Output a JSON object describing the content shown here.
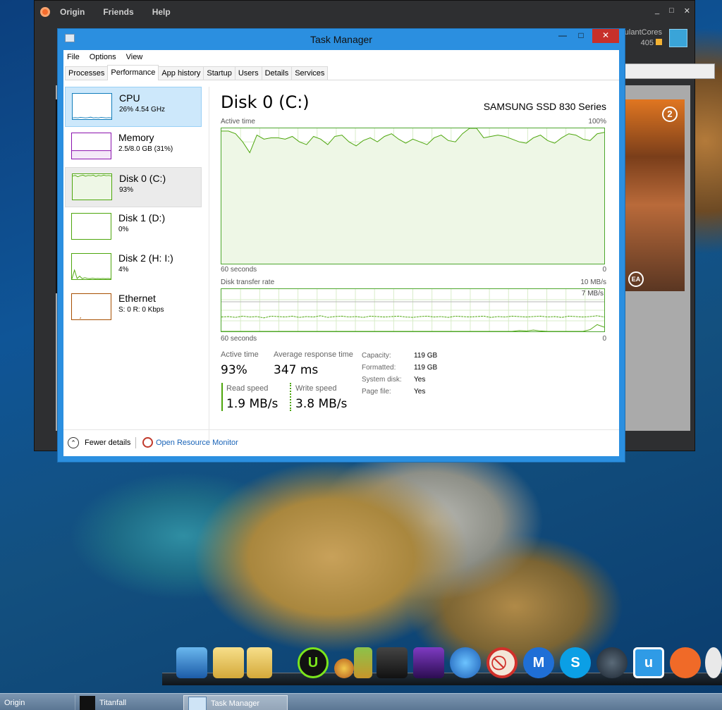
{
  "origin": {
    "menu": [
      "Origin",
      "Friends",
      "Help"
    ],
    "window_controls": [
      "_",
      "□",
      "✕"
    ],
    "user_name": "ulantCores",
    "user_points": "405"
  },
  "task_manager": {
    "title": "Task Manager",
    "menu": [
      "File",
      "Options",
      "View"
    ],
    "tabs": [
      "Processes",
      "Performance",
      "App history",
      "Startup",
      "Users",
      "Details",
      "Services"
    ],
    "active_tab": "Performance",
    "sidebar": [
      {
        "name": "CPU",
        "value": "26% 4.54 GHz",
        "color": "#117dbb"
      },
      {
        "name": "Memory",
        "value": "2.5/8.0 GB (31%)",
        "color": "#8b12ae"
      },
      {
        "name": "Disk 0 (C:)",
        "value": "93%",
        "color": "#4da60c"
      },
      {
        "name": "Disk 1 (D:)",
        "value": "0%",
        "color": "#4da60c"
      },
      {
        "name": "Disk 2 (H: I:)",
        "value": "4%",
        "color": "#4da60c"
      },
      {
        "name": "Ethernet",
        "value": "S: 0 R: 0 Kbps",
        "color": "#a74f01"
      }
    ],
    "detail": {
      "title": "Disk 0 (C:)",
      "model": "SAMSUNG SSD 830 Series",
      "graph1": {
        "label": "Active time",
        "max": "100%",
        "xlabel": "60 seconds",
        "xend": "0"
      },
      "graph2": {
        "label": "Disk transfer rate",
        "max": "10 MB/s",
        "line_label": "7 MB/s",
        "xlabel": "60 seconds",
        "xend": "0"
      },
      "stats": {
        "active_time_label": "Active time",
        "active_time": "93%",
        "avg_response_label": "Average response time",
        "avg_response": "347 ms",
        "read_label": "Read speed",
        "read": "1.9 MB/s",
        "write_label": "Write speed",
        "write": "3.8 MB/s"
      },
      "props": [
        {
          "key": "Capacity:",
          "value": "119 GB"
        },
        {
          "key": "Formatted:",
          "value": "119 GB"
        },
        {
          "key": "System disk:",
          "value": "Yes"
        },
        {
          "key": "Page file:",
          "value": "Yes"
        }
      ]
    },
    "footer": {
      "fewer": "Fewer details",
      "resource_monitor": "Open Resource Monitor"
    },
    "active_time_series": [
      98,
      98,
      96,
      90,
      82,
      95,
      92,
      93,
      93,
      92,
      94,
      90,
      88,
      94,
      92,
      88,
      94,
      95,
      90,
      87,
      91,
      93,
      90,
      94,
      96,
      92,
      89,
      92,
      90,
      88,
      93,
      95,
      91,
      90,
      96,
      100,
      100,
      93,
      94,
      95,
      94,
      92,
      90,
      89,
      93,
      95,
      91,
      89,
      93,
      96,
      95,
      92,
      91,
      96,
      97
    ],
    "transfer_series": [
      3.4,
      3.5,
      3.3,
      3.6,
      3.4,
      3.5,
      3.2,
      3.6,
      3.5,
      3.4,
      3.6,
      3.3,
      3.5,
      3.4,
      3.7,
      3.3,
      3.5,
      3.6,
      3.4,
      3.5,
      3.3,
      3.6,
      3.5,
      3.4,
      3.5,
      3.6,
      3.4,
      3.3,
      3.5,
      3.6,
      3.4,
      3.5,
      3.3,
      3.6,
      3.5,
      3.4,
      3.5,
      3.6,
      3.3,
      3.5,
      3.4,
      3.6,
      3.5,
      3.4,
      3.5,
      3.6,
      3.4,
      3.5,
      3.3,
      3.6,
      3.5,
      3.4,
      3.5,
      3.7,
      3.4
    ],
    "transfer_series2": [
      0,
      0,
      0,
      0,
      0,
      0,
      0,
      0,
      0,
      0,
      0,
      0,
      0,
      0,
      0,
      0,
      0,
      0,
      0,
      0,
      0,
      0,
      0,
      0,
      0,
      0,
      0,
      0,
      0,
      0,
      0,
      0,
      0,
      0,
      0,
      0,
      0,
      0,
      0,
      0,
      0,
      0,
      0.2,
      0.1,
      0.3,
      0.1,
      0,
      0,
      0,
      0,
      0,
      0,
      0.4,
      1.6,
      1.0
    ],
    "sidebar_sparks": {
      "cpu": [
        0.5,
        0.6,
        0.5,
        0.7,
        0.6,
        0.5,
        0.6,
        0.8,
        0.5,
        0.6,
        0.5,
        0.7,
        0.6,
        0.5,
        0.6,
        0.5
      ],
      "memory": [
        3.1,
        3.1,
        3.1,
        3.1,
        3.1,
        3.1,
        3.1,
        3.1,
        3.1,
        3.1,
        3.1,
        3.1,
        3.1,
        3.1,
        3.1,
        3.1
      ],
      "disk0": [
        9.3,
        9.5,
        9.0,
        9.4,
        9.6,
        9.2,
        9.5,
        9.4,
        9.6,
        9.1,
        9.5,
        9.3,
        9.6,
        9.4,
        9.5,
        9.3
      ],
      "disk1": [
        0,
        0,
        0,
        0,
        0,
        0,
        0,
        0,
        0,
        0,
        0,
        0,
        0,
        0,
        0,
        0
      ],
      "disk2": [
        0.1,
        3.6,
        0.3,
        1.2,
        0.2,
        0.6,
        0.3,
        0.2,
        0.4,
        0.2,
        0.3,
        0.2,
        0.3,
        0.2,
        0.3,
        0.2
      ],
      "ethernet": [
        0,
        0,
        0,
        0,
        0,
        0,
        0,
        0,
        0,
        0,
        0,
        0,
        0,
        0,
        0,
        0
      ]
    }
  },
  "dock": {
    "icons": [
      "computer-icon",
      "folder-icon",
      "folder-icon",
      "iobit-icon",
      "cocktail-icon",
      "pineapple-icon",
      "clapper-icon",
      "video-editor-icon",
      "thunderbird-icon",
      "block-icon",
      "malwarebytes-icon",
      "skype-icon",
      "steam-dark-icon",
      "uplay-icon",
      "origin-icon",
      "steam-icon"
    ]
  },
  "taskbar": {
    "items": [
      "Origin",
      "Titanfall",
      "Task Manager"
    ],
    "active": "Task Manager"
  }
}
